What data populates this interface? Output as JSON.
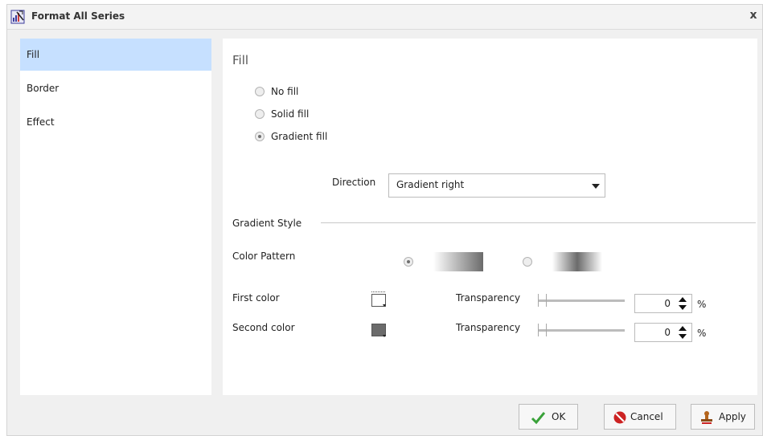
{
  "window": {
    "title": "Format All Series",
    "close_label": "x"
  },
  "sidebar": {
    "items": [
      {
        "label": "Fill",
        "selected": true
      },
      {
        "label": "Border",
        "selected": false
      },
      {
        "label": "Effect",
        "selected": false
      }
    ]
  },
  "fill": {
    "section_title": "Fill",
    "options": [
      {
        "label": "No fill",
        "checked": false
      },
      {
        "label": "Solid fill",
        "checked": false
      },
      {
        "label": "Gradient fill",
        "checked": true
      }
    ],
    "direction_label": "Direction",
    "direction_value": "Gradient right",
    "gradient_style_label": "Gradient Style",
    "color_pattern_label": "Color Pattern",
    "first_color_label": "First color",
    "second_color_label": "Second color",
    "transparency_label": "Transparency",
    "first_transparency": "0",
    "second_transparency": "0",
    "percent_sign": "%"
  },
  "buttons": {
    "ok": "OK",
    "cancel": "Cancel",
    "apply": "Apply"
  },
  "colors": {
    "selected_nav": "#c6e0ff",
    "panel_bg": "#ffffff",
    "dialog_bg": "#f0f0f0",
    "second_color": "#6b6b6b"
  },
  "icons": {
    "title": "chart-format-icon",
    "ok": "checkmark-icon",
    "cancel": "no-entry-icon",
    "apply": "stamp-icon"
  }
}
